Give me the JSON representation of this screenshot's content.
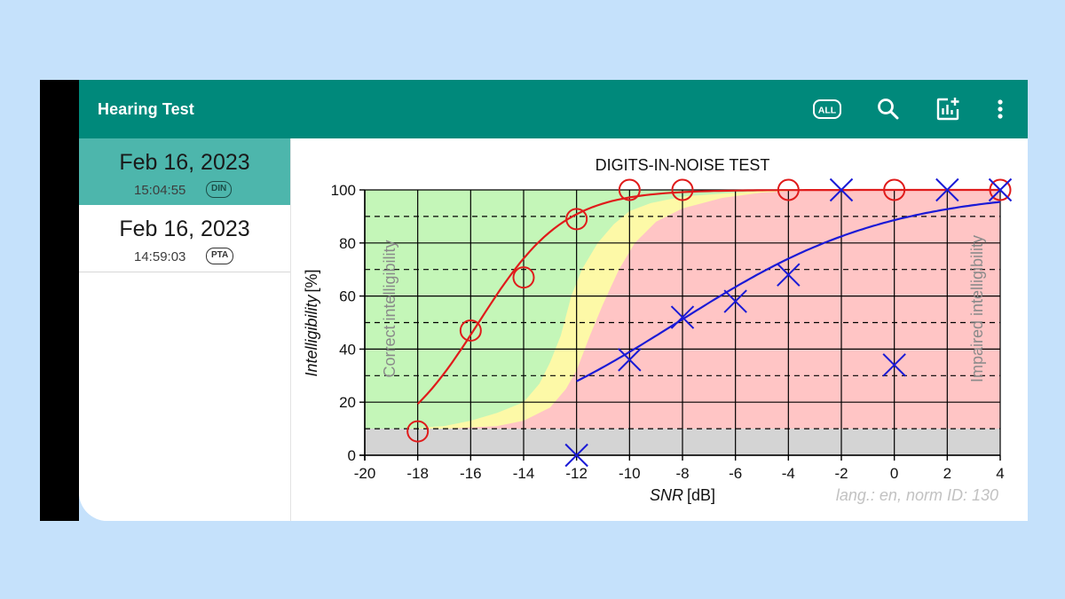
{
  "app": {
    "title": "Hearing Test"
  },
  "toolbar": {
    "actions": [
      {
        "icon": "all-icon",
        "label": "ALL"
      },
      {
        "icon": "search-icon"
      },
      {
        "icon": "add-chart-icon"
      },
      {
        "icon": "more-vert-icon"
      }
    ]
  },
  "sidebar": {
    "items": [
      {
        "date": "Feb 16, 2023",
        "time": "15:04:55",
        "badge": "DIN",
        "selected": true
      },
      {
        "date": "Feb 16, 2023",
        "time": "14:59:03",
        "badge": "PTA",
        "selected": false
      }
    ]
  },
  "colors": {
    "appbar": "#00897b",
    "selected": "#4db6ac",
    "zone_correct": "#c4f6b8",
    "zone_borderline": "#fdf9a7",
    "zone_impaired": "#ffc5c5",
    "zone_floor": "#d4d4d4",
    "series_red": "#e01b1b",
    "series_blue": "#1a1ad6"
  },
  "chart_data": {
    "type": "scatter",
    "title": "DIGITS-IN-NOISE TEST",
    "xlabel_italic": "SNR",
    "xlabel_unit": "[dB]",
    "ylabel_italic": "Intelligibility",
    "ylabel_unit": "[%]",
    "xlim": [
      -20,
      4
    ],
    "ylim": [
      0,
      100
    ],
    "xticks": [
      -20,
      -18,
      -16,
      -14,
      -12,
      -10,
      -8,
      -6,
      -4,
      -2,
      0,
      2,
      4
    ],
    "yticks": [
      0,
      20,
      40,
      60,
      80,
      100
    ],
    "dashed_y": [
      10,
      30,
      50,
      70,
      90
    ],
    "grid": true,
    "zone_labels": {
      "correct": "Correct intelligibility",
      "impaired": "Impaired intelligibility"
    },
    "footnote": "lang.: en, norm ID: 130",
    "zones": {
      "green_to_yellow": [
        [
          -18.5,
          10
        ],
        [
          -17,
          11
        ],
        [
          -16,
          13
        ],
        [
          -15,
          16
        ],
        [
          -14,
          20
        ],
        [
          -13.4,
          27
        ],
        [
          -13,
          35
        ],
        [
          -12.6,
          45
        ],
        [
          -12.2,
          60
        ],
        [
          -11.8,
          70
        ],
        [
          -11.2,
          80
        ],
        [
          -10.6,
          87
        ],
        [
          -10,
          92
        ],
        [
          -9.2,
          95
        ],
        [
          -8,
          97.5
        ],
        [
          -6,
          99
        ],
        [
          -4,
          100
        ]
      ],
      "yellow_to_red": [
        [
          -17,
          10
        ],
        [
          -15,
          11
        ],
        [
          -14,
          13
        ],
        [
          -13,
          18
        ],
        [
          -12.4,
          25
        ],
        [
          -12,
          32
        ],
        [
          -11.5,
          45
        ],
        [
          -11,
          57
        ],
        [
          -10.4,
          70
        ],
        [
          -9.8,
          80
        ],
        [
          -9,
          88
        ],
        [
          -8,
          93
        ],
        [
          -6.5,
          97
        ],
        [
          -5,
          99
        ],
        [
          -3,
          100
        ]
      ]
    },
    "series": [
      {
        "marker": "circle",
        "color": "#e01b1b",
        "points": [
          [
            -18,
            9
          ],
          [
            -16,
            47
          ],
          [
            -14,
            67
          ],
          [
            -12,
            89
          ],
          [
            -10,
            100
          ],
          [
            -8,
            100
          ],
          [
            -4,
            100
          ],
          [
            0,
            100
          ],
          [
            4,
            100
          ]
        ],
        "fit": {
          "x0": -15.7,
          "slope": 0.62,
          "from": -18,
          "to": 4
        }
      },
      {
        "marker": "cross",
        "color": "#1a1ad6",
        "points": [
          [
            -12,
            0
          ],
          [
            -10,
            36
          ],
          [
            -8,
            52
          ],
          [
            -6,
            58
          ],
          [
            -4,
            68
          ],
          [
            -2,
            100
          ],
          [
            0,
            34
          ],
          [
            2,
            100
          ],
          [
            4,
            100
          ]
        ],
        "fit": {
          "x0": -8.2,
          "slope": 0.25,
          "from": -12,
          "to": 4
        }
      }
    ]
  }
}
